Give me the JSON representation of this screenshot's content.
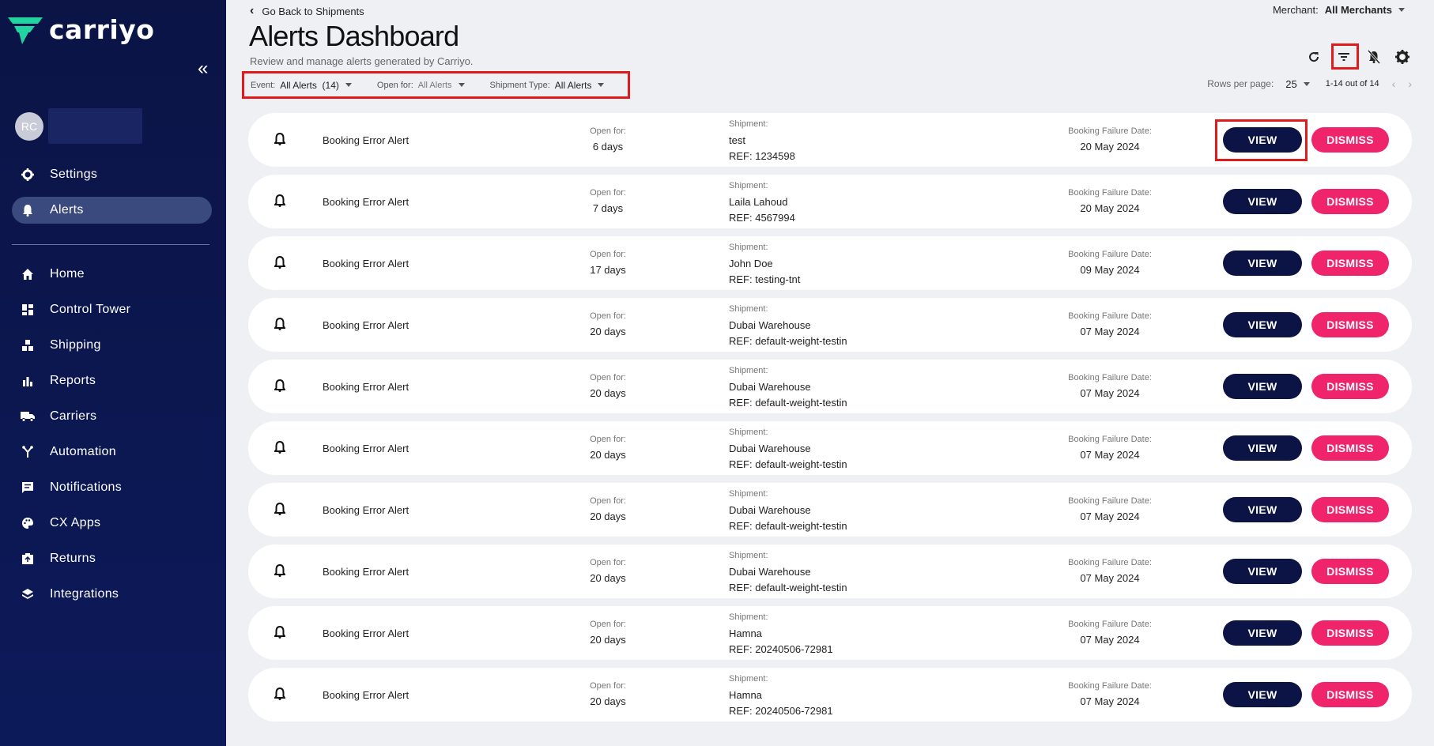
{
  "app": {
    "name": "carriyo"
  },
  "user": {
    "initials": "RC"
  },
  "sidebar": {
    "collapse_icon": "double-chevron-left-icon",
    "top_items": [
      {
        "label": "Settings",
        "icon": "gear-icon"
      },
      {
        "label": "Alerts",
        "icon": "bell-icon",
        "active": true
      }
    ],
    "items": [
      {
        "label": "Home",
        "icon": "home-icon"
      },
      {
        "label": "Control Tower",
        "icon": "dashboard-icon"
      },
      {
        "label": "Shipping",
        "icon": "boxes-icon"
      },
      {
        "label": "Reports",
        "icon": "bar-chart-icon"
      },
      {
        "label": "Carriers",
        "icon": "truck-icon"
      },
      {
        "label": "Automation",
        "icon": "automation-icon"
      },
      {
        "label": "Notifications",
        "icon": "message-icon"
      },
      {
        "label": "CX Apps",
        "icon": "palette-icon"
      },
      {
        "label": "Returns",
        "icon": "return-box-icon"
      },
      {
        "label": "Integrations",
        "icon": "layers-icon"
      }
    ]
  },
  "header": {
    "back_label": "Go Back to Shipments",
    "title": "Alerts Dashboard",
    "subtitle": "Review and manage alerts generated by Carriyo.",
    "merchant_label": "Merchant:",
    "merchant_value": "All Merchants"
  },
  "filters": {
    "event_label": "Event:",
    "event_value": "All Alerts  (14)",
    "open_label": "Open for:",
    "open_value": "All Alerts",
    "type_label": "Shipment Type:",
    "type_value": "All Alerts"
  },
  "pagination": {
    "rows_label": "Rows per page:",
    "rows_value": "25",
    "range": "1-14 out of 14"
  },
  "labels": {
    "open_for": "Open for:",
    "shipment": "Shipment:",
    "failure_date": "Booking Failure Date:",
    "view": "VIEW",
    "dismiss": "DISMISS"
  },
  "alerts": [
    {
      "name": "Booking Error Alert",
      "open": "6 days",
      "shipment": "test",
      "ref": "REF: 1234598",
      "date": "20 May 2024"
    },
    {
      "name": "Booking Error Alert",
      "open": "7 days",
      "shipment": "Laila Lahoud",
      "ref": "REF: 4567994",
      "date": "20 May 2024"
    },
    {
      "name": "Booking Error Alert",
      "open": "17 days",
      "shipment": "John Doe",
      "ref": "REF: testing-tnt",
      "date": "09 May 2024"
    },
    {
      "name": "Booking Error Alert",
      "open": "20 days",
      "shipment": "Dubai Warehouse",
      "ref": "REF: default-weight-testin",
      "date": "07 May 2024"
    },
    {
      "name": "Booking Error Alert",
      "open": "20 days",
      "shipment": "Dubai Warehouse",
      "ref": "REF: default-weight-testin",
      "date": "07 May 2024"
    },
    {
      "name": "Booking Error Alert",
      "open": "20 days",
      "shipment": "Dubai Warehouse",
      "ref": "REF: default-weight-testin",
      "date": "07 May 2024"
    },
    {
      "name": "Booking Error Alert",
      "open": "20 days",
      "shipment": "Dubai Warehouse",
      "ref": "REF: default-weight-testin",
      "date": "07 May 2024"
    },
    {
      "name": "Booking Error Alert",
      "open": "20 days",
      "shipment": "Dubai Warehouse",
      "ref": "REF: default-weight-testin",
      "date": "07 May 2024"
    },
    {
      "name": "Booking Error Alert",
      "open": "20 days",
      "shipment": "Hamna",
      "ref": "REF: 20240506-72981",
      "date": "07 May 2024"
    },
    {
      "name": "Booking Error Alert",
      "open": "20 days",
      "shipment": "Hamna",
      "ref": "REF: 20240506-72981",
      "date": "07 May 2024"
    }
  ],
  "colors": {
    "sidebar": "#0b1445",
    "view": "#0b1445",
    "dismiss": "#f0246b",
    "highlight": "#e01b1b"
  }
}
